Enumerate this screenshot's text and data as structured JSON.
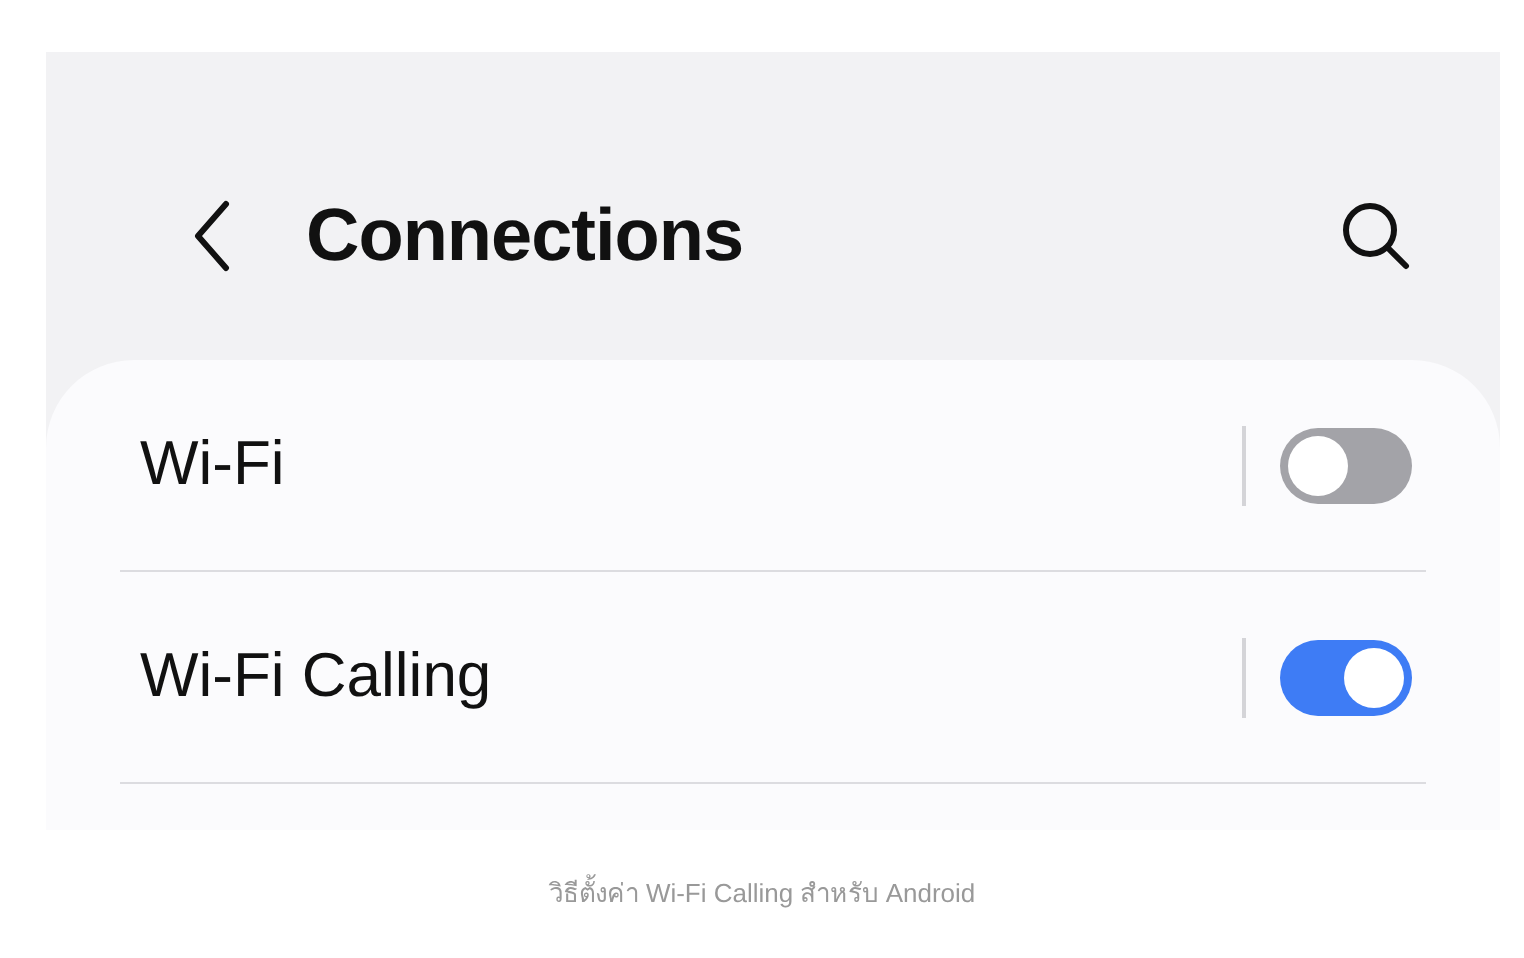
{
  "header": {
    "title": "Connections"
  },
  "settings": [
    {
      "label": "Wi-Fi",
      "on": false
    },
    {
      "label": "Wi-Fi Calling",
      "on": true
    }
  ],
  "caption": "วิธีตั้งค่า Wi-Fi Calling สำหรับ Android"
}
